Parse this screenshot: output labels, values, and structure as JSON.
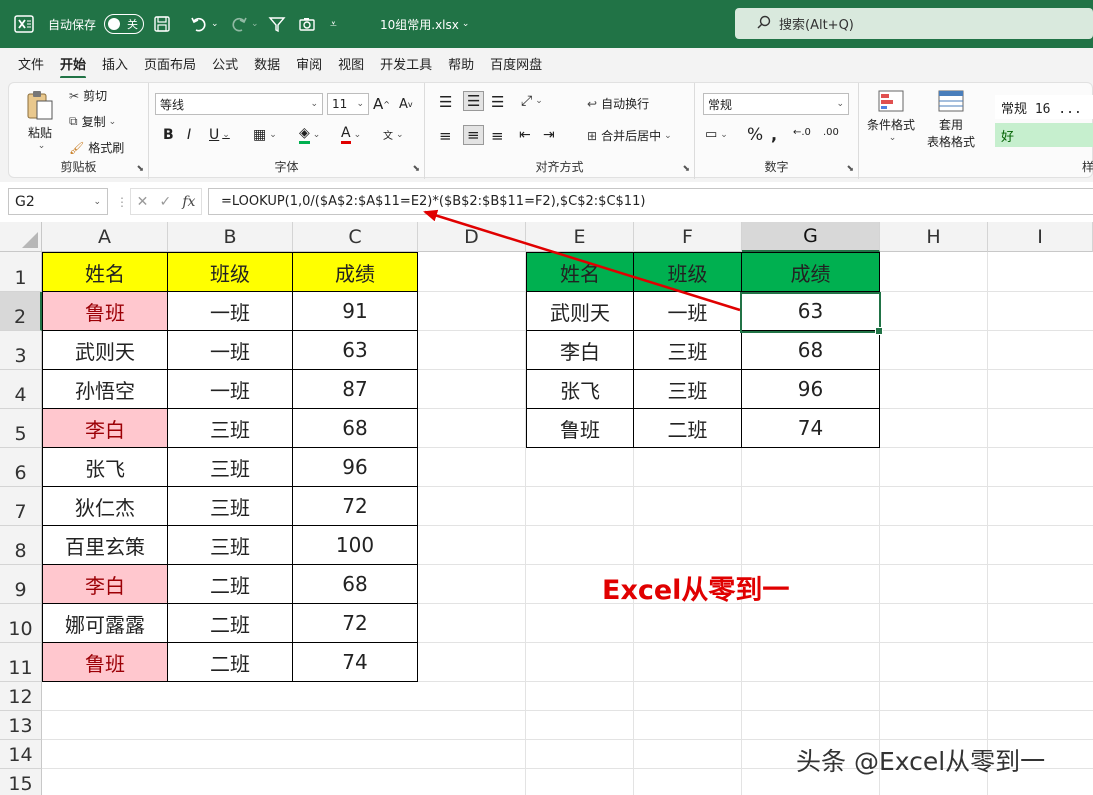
{
  "titlebar": {
    "autosave_label": "自动保存",
    "autosave_state": "关",
    "filename": "10组常用.xlsx",
    "search_placeholder": "搜索(Alt+Q)"
  },
  "menu": {
    "tabs": [
      "文件",
      "开始",
      "插入",
      "页面布局",
      "公式",
      "数据",
      "审阅",
      "视图",
      "开发工具",
      "帮助",
      "百度网盘"
    ],
    "active": "开始"
  },
  "ribbon": {
    "clipboard": {
      "paste": "粘贴",
      "cut": "剪切",
      "copy": "复制",
      "format_painter": "格式刷",
      "label": "剪贴板"
    },
    "font": {
      "font_name": "等线",
      "font_size": "11",
      "label": "字体"
    },
    "alignment": {
      "wrap_text": "自动换行",
      "merge_center": "合并后居中",
      "label": "对齐方式"
    },
    "number": {
      "format": "常规",
      "label": "数字"
    },
    "styles": {
      "conditional": "条件格式",
      "table_format_1": "套用",
      "table_format_2": "表格格式",
      "normal_style": "常规 16 ...",
      "good_style": "好",
      "label": "样"
    }
  },
  "formula_bar": {
    "name_box": "G2",
    "formula": "=LOOKUP(1,0/($A$2:$A$11=E2)*($B$2:$B$11=F2),$C$2:$C$11)"
  },
  "columns": [
    "A",
    "B",
    "C",
    "D",
    "E",
    "F",
    "G",
    "H",
    "I"
  ],
  "rows": [
    "1",
    "2",
    "3",
    "4",
    "5",
    "6",
    "7",
    "8",
    "9",
    "10",
    "11",
    "12",
    "13",
    "14",
    "15"
  ],
  "table1": {
    "headers": [
      "姓名",
      "班级",
      "成绩"
    ],
    "rows": [
      [
        "鲁班",
        "一班",
        "91"
      ],
      [
        "武则天",
        "一班",
        "63"
      ],
      [
        "孙悟空",
        "一班",
        "87"
      ],
      [
        "李白",
        "三班",
        "68"
      ],
      [
        "张飞",
        "三班",
        "96"
      ],
      [
        "狄仁杰",
        "三班",
        "72"
      ],
      [
        "百里玄策",
        "三班",
        "100"
      ],
      [
        "李白",
        "二班",
        "68"
      ],
      [
        "娜可露露",
        "二班",
        "72"
      ],
      [
        "鲁班",
        "二班",
        "74"
      ]
    ],
    "highlight_color": "#ffc7ce",
    "header_color": "#ffff00"
  },
  "table2": {
    "headers": [
      "姓名",
      "班级",
      "成绩"
    ],
    "rows": [
      [
        "武则天",
        "一班",
        "63"
      ],
      [
        "李白",
        "三班",
        "68"
      ],
      [
        "张飞",
        "三班",
        "96"
      ],
      [
        "鲁班",
        "二班",
        "74"
      ]
    ],
    "header_color": "#00b050"
  },
  "annotations": {
    "brand_red": "Excel从零到一",
    "watermark": "头条 @Excel从零到一",
    "arrow_color": "#e00000"
  }
}
